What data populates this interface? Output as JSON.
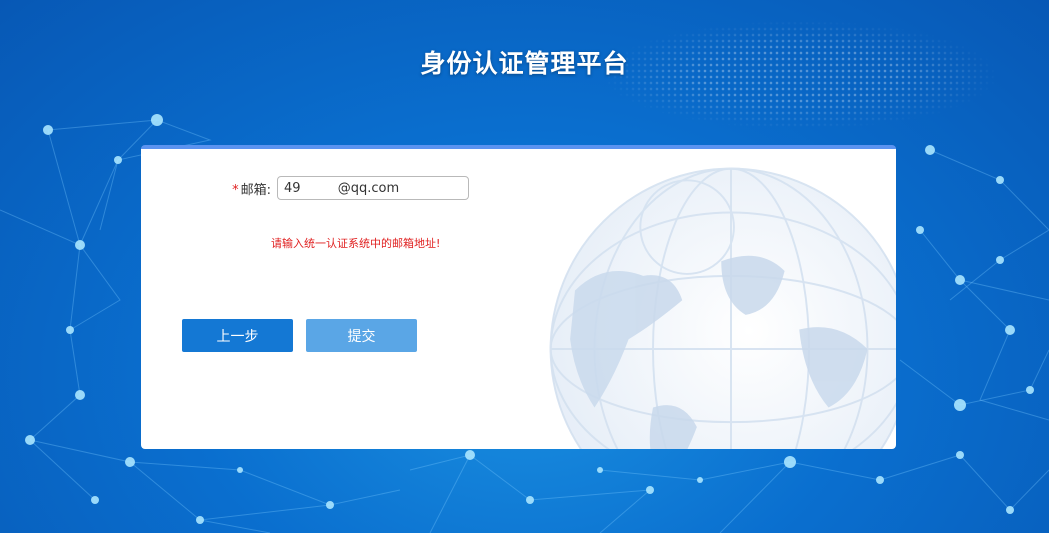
{
  "page": {
    "title": "身份认证管理平台"
  },
  "form": {
    "email_label": "邮箱:",
    "required_mark": "*",
    "email_value": "49         @qq.com",
    "error_message": "请输入统一认证系统中的邮箱地址!"
  },
  "buttons": {
    "prev_label": "上一步",
    "submit_label": "提交"
  },
  "icons": {
    "background": "network-background-icon",
    "globe": "globe-icon"
  },
  "colors": {
    "primary": "#1478d4",
    "submit": "#5aa6e6",
    "error": "#e02020",
    "card_top_border": "#5b93f0"
  }
}
